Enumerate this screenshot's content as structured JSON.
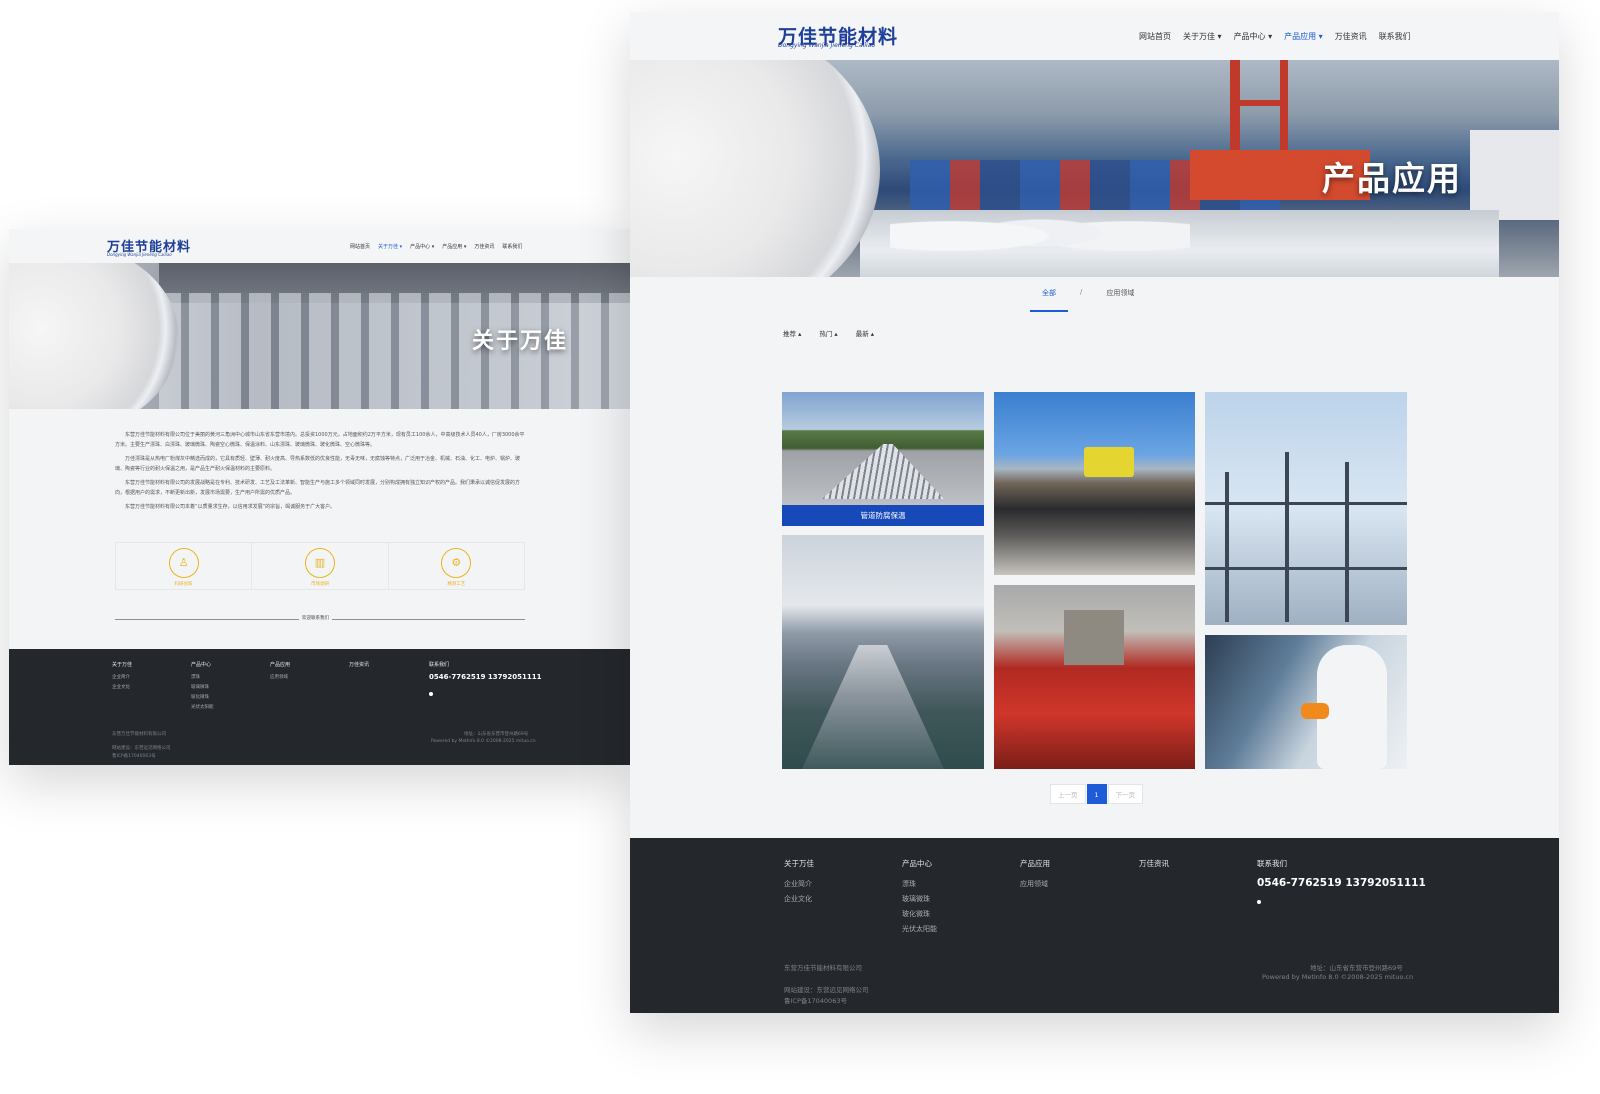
{
  "site": {
    "logo_cn": "万佳节能材料",
    "logo_en": "Dongying Wanjia Jieneng Cailiao",
    "brand_color": "#1e3f9a",
    "accent_color": "#1e5bd6",
    "footer_bg": "#24272c",
    "feature_color": "#e8b520"
  },
  "about_page": {
    "nav": [
      {
        "label": "网站首页"
      },
      {
        "label": "关于万佳 ▾"
      },
      {
        "label": "产品中心 ▾"
      },
      {
        "label": "产品应用 ▾"
      },
      {
        "label": "万佳资讯"
      },
      {
        "label": "联系我们"
      }
    ],
    "banner_title": "关于万佳",
    "paragraphs": [
      "东营万佳节能材料有限公司位于美丽的黄河三角洲中心城市山东省东营市境内。总投资1000万元，占地面积约2万平方米，现有员工100余人，中高级技术人员40人，厂房3000余平方米。主要生产漂珠、白漂珠、玻璃微珠、陶瓷空心微珠、保温涂料、山东漂珠、玻璃微珠、玻化微珠、空心微珠等。",
      "万佳漂珠是从热电厂粉煤灰中精选而成的，它具有质轻、壁薄、耐火度高、导热系数低的优良性能，无毒无味，无腐蚀等特点，广泛用于冶金、机械、石油、化工、电炉、锅炉、玻璃、陶瓷等行业的耐火保温之用，是产品生产耐火保温材料的主要原料。",
      "东营万佳节能材料有限公司的发展战略是在专利、技术研发、工艺及工法革新、智能生产与施工多个领域同时发展，分别构成拥有独立知识产权的产品。我们秉承以诚信促发展的方向，根据用户的需求，不断更新出新，发展市场需要，生产用户所需的优质产品。",
      "东营万佳节能材料有限公司本着“以质量求生存，以信用求发展”的宗旨，竭诚服务于广大客户。"
    ],
    "features": [
      {
        "label": "科研创新",
        "icon": "flask-icon",
        "glyph": "♙"
      },
      {
        "label": "市场调研",
        "icon": "building-icon",
        "glyph": "▥"
      },
      {
        "label": "精湛工艺",
        "icon": "cart-icon",
        "glyph": "⚙"
      }
    ],
    "divider_label": "欢迎联系我们",
    "footer": {
      "columns": [
        {
          "head": "关于万佳",
          "items": [
            "企业简介",
            "企业文化"
          ]
        },
        {
          "head": "产品中心",
          "items": [
            "漂珠",
            "玻璃微珠",
            "玻化微珠",
            "光伏太阳能"
          ]
        },
        {
          "head": "产品应用",
          "items": [
            "应用领域"
          ]
        },
        {
          "head": "万佳资讯",
          "items": []
        }
      ],
      "contact_head": "联系我们",
      "phone": "0546-7762519 13792051111",
      "company": "东营万佳节能材料有限公司",
      "builder": "网站建设：东营远见网络公司",
      "icp": "鲁ICP备17040063号",
      "address": "地址：山东省东营市登州路69号",
      "powered": "Powered by MetInfo 8.0 ©2008-2025  mituo.cn"
    }
  },
  "app_page": {
    "nav": [
      {
        "label": "网站首页"
      },
      {
        "label": "关于万佳 ▾"
      },
      {
        "label": "产品中心 ▾"
      },
      {
        "label": "产品应用 ▾"
      },
      {
        "label": "万佳资讯"
      },
      {
        "label": "联系我们"
      }
    ],
    "banner_title": "产品应用",
    "tabs": {
      "all": "全部",
      "sep": "/",
      "field": "应用领域"
    },
    "filters": [
      "推荐 ▴",
      "热门 ▴",
      "最新 ▴"
    ],
    "images": [
      {
        "caption": "管道防腐保温"
      }
    ],
    "pager": {
      "prev": "上一页",
      "current": "1",
      "next": "下一页"
    },
    "footer": {
      "columns": [
        {
          "head": "关于万佳",
          "items": [
            "企业简介",
            "企业文化"
          ]
        },
        {
          "head": "产品中心",
          "items": [
            "漂珠",
            "玻璃微珠",
            "玻化微珠",
            "光伏太阳能"
          ]
        },
        {
          "head": "产品应用",
          "items": [
            "应用领域"
          ]
        },
        {
          "head": "万佳资讯",
          "items": []
        }
      ],
      "contact_head": "联系我们",
      "phone": "0546-7762519 13792051111",
      "company": "东营万佳节能材料有限公司",
      "builder": "网站建设：东营远见网络公司",
      "icp": "鲁ICP备17040063号",
      "address": "地址：山东省东营市登州路69号",
      "powered": "Powered by MetInfo 8.0 ©2008-2025  mituo.cn"
    }
  }
}
